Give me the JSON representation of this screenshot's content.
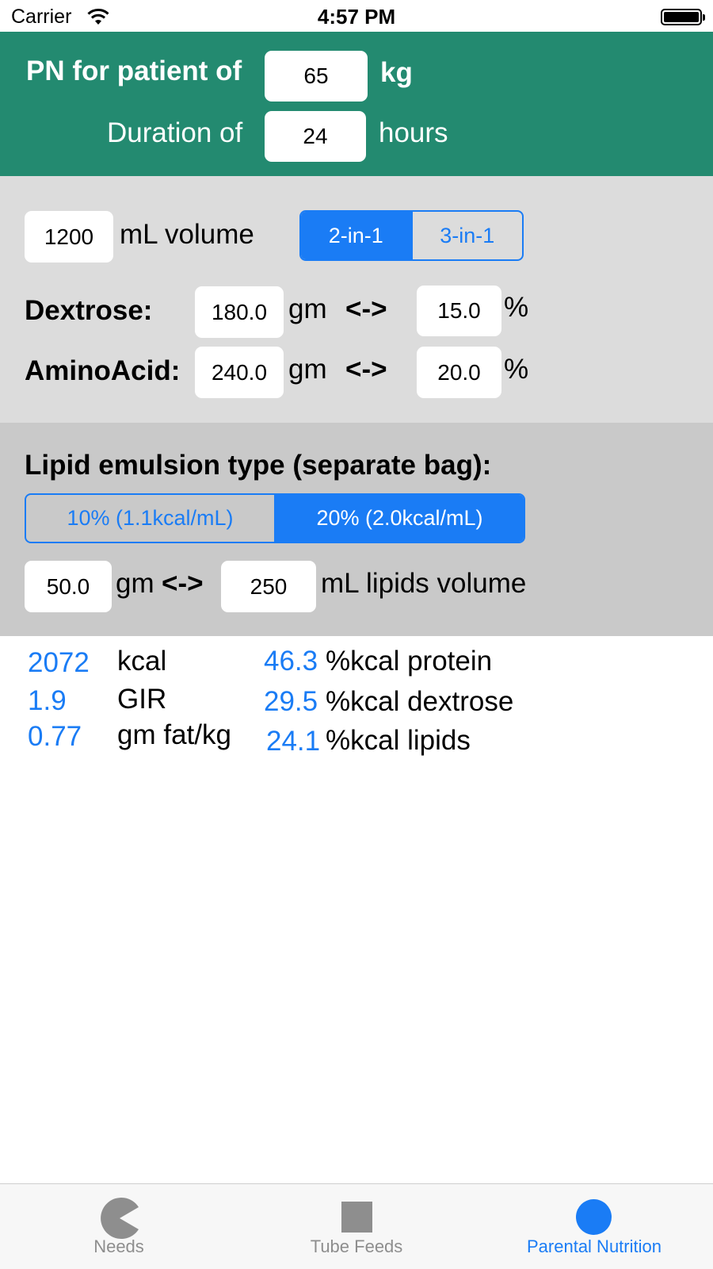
{
  "status_bar": {
    "carrier": "Carrier",
    "time": "4:57 PM"
  },
  "header": {
    "patient_label": "PN for patient of",
    "weight_value": "65",
    "weight_unit": "kg",
    "duration_label": "Duration of",
    "duration_value": "24",
    "duration_unit": "hours"
  },
  "solution": {
    "volume_value": "1200",
    "volume_label": "mL volume",
    "mix_options": [
      "2-in-1",
      "3-in-1"
    ],
    "mix_selected": "2-in-1",
    "dextrose": {
      "label": "Dextrose:",
      "gm_value": "180.0",
      "gm_unit": "gm",
      "arrow": "<->",
      "pct_value": "15.0",
      "pct_unit": "%"
    },
    "amino_acid": {
      "label": "AminoAcid:",
      "gm_value": "240.0",
      "gm_unit": "gm",
      "arrow": "<->",
      "pct_value": "20.0",
      "pct_unit": "%"
    }
  },
  "lipid": {
    "title": "Lipid emulsion type (separate bag):",
    "options": [
      "10% (1.1kcal/mL)",
      "20% (2.0kcal/mL)"
    ],
    "selected": "20% (2.0kcal/mL)",
    "gm_value": "50.0",
    "gm_unit": "gm",
    "arrow": "<->",
    "ml_value": "250",
    "ml_label": "mL lipids volume"
  },
  "results": {
    "kcal_value": "2072",
    "kcal_label": "kcal",
    "gir_value": "1.9",
    "gir_label": "GIR",
    "fat_value": "0.77",
    "fat_label": "gm fat/kg",
    "protein_pct_value": "46.3",
    "protein_pct_label": "%kcal protein",
    "dextrose_pct_value": "29.5",
    "dextrose_pct_label": "%kcal dextrose",
    "lipids_pct_value": "24.1",
    "lipids_pct_label": "%kcal lipids"
  },
  "tab_bar": {
    "tabs": [
      {
        "label": "Needs",
        "icon": "pacman-icon"
      },
      {
        "label": "Tube Feeds",
        "icon": "square-icon"
      },
      {
        "label": "Parental Nutrition",
        "icon": "circle-icon"
      }
    ],
    "active": "Parental Nutrition"
  },
  "colors": {
    "header_bg": "#238a70",
    "accent": "#1a7cf5",
    "section2_bg": "#dcdcdc",
    "section3_bg": "#c9c9c9",
    "tab_inactive": "#8e8e8e"
  }
}
